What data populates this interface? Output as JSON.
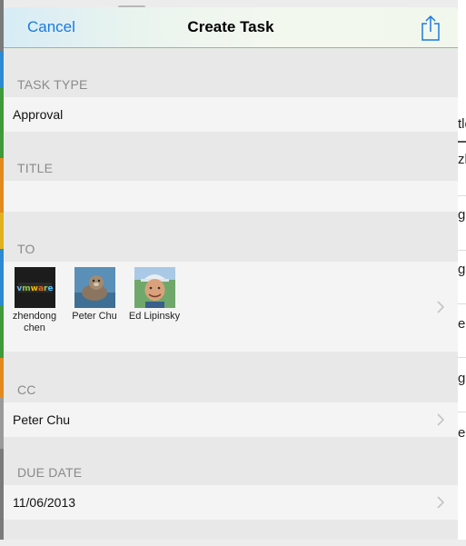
{
  "header": {
    "cancel_label": "Cancel",
    "title": "Create Task",
    "share_icon": "share-icon"
  },
  "task_type": {
    "label": "TASK TYPE",
    "value": "Approval"
  },
  "title_field": {
    "label": "TITLE",
    "value": ""
  },
  "to": {
    "label": "TO",
    "recipients": [
      {
        "name": "zhendong chen",
        "avatar": "vmware-logo-avatar"
      },
      {
        "name": "Peter Chu",
        "avatar": "otter-photo-avatar"
      },
      {
        "name": "Ed Lipinsky",
        "avatar": "man-in-hat-photo-avatar"
      }
    ]
  },
  "cc": {
    "label": "CC",
    "value": "Peter Chu"
  },
  "due_date": {
    "label": "DUE DATE",
    "value": "11/06/2013"
  },
  "background_list": {
    "fragments": [
      "tle",
      "zh",
      "g",
      "g",
      "e",
      "g",
      "e"
    ]
  },
  "colors": {
    "accent": "#1a7ae0",
    "section_label": "#8a8a8a",
    "sheet_background": "#e8e8e8",
    "row_background": "#f4f4f4"
  }
}
